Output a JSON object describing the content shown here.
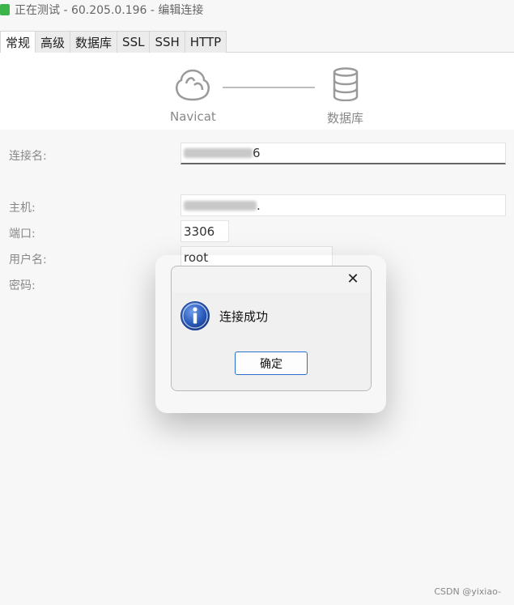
{
  "window": {
    "title": "正在测试 - 60.205.0.196 - 编辑连接",
    "icon": "navicat-app-icon"
  },
  "tabs": [
    {
      "label": "常规",
      "active": true
    },
    {
      "label": "高级",
      "active": false
    },
    {
      "label": "数据库",
      "active": false
    },
    {
      "label": "SSL",
      "active": false
    },
    {
      "label": "SSH",
      "active": false
    },
    {
      "label": "HTTP",
      "active": false
    }
  ],
  "connection_header": {
    "left_label": "Navicat",
    "right_label": "数据库",
    "left_icon": "navicat-logo-icon",
    "right_icon": "database-icon"
  },
  "form": {
    "connection_name_label": "连接名:",
    "connection_name_value": "6",
    "host_label": "主机:",
    "host_value": ".",
    "port_label": "端口:",
    "port_value": "3306",
    "username_label": "用户名:",
    "username_value": "root",
    "password_label": "密码:"
  },
  "dialog": {
    "message": "连接成功",
    "ok_label": "确定",
    "close_icon": "close-icon",
    "info_icon": "info-icon"
  },
  "watermark": "CSDN @yixiao-",
  "colors": {
    "dialog_button_border": "#2a6fc9",
    "app_icon": "#3bb54a"
  }
}
